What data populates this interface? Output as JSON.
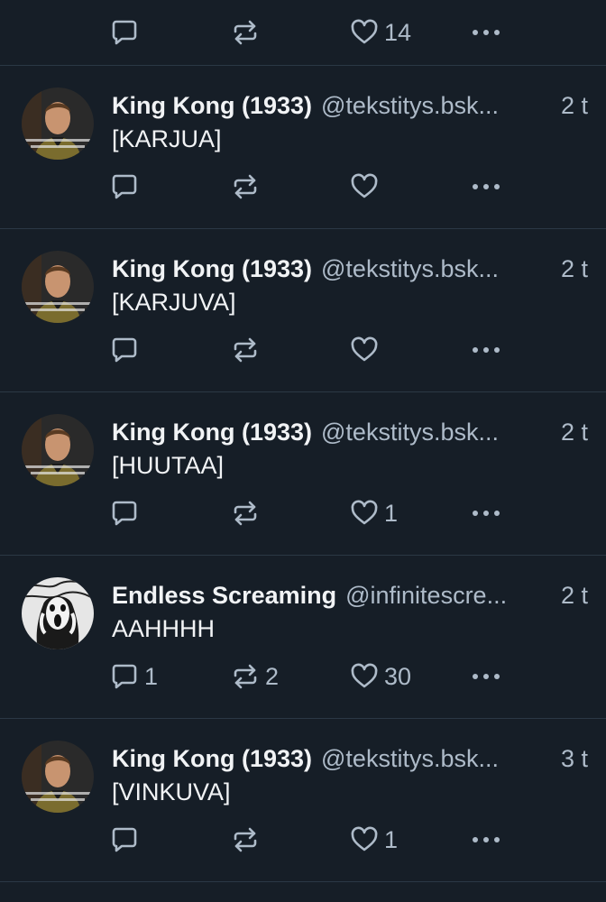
{
  "colors": {
    "background": "#161e27",
    "divider": "#2b3845",
    "text_primary": "#f1f3f5",
    "text_secondary": "#aebbc9"
  },
  "top_actions": {
    "reply_count": "",
    "repost_count": "",
    "like_count": "14"
  },
  "posts": [
    {
      "avatar_icon": "kirk-avatar",
      "display_name": "King Kong (1933)",
      "handle": "@tekstitys.bsk...",
      "time": "2 t",
      "text": "[KARJUA]",
      "reply_count": "",
      "repost_count": "",
      "like_count": ""
    },
    {
      "avatar_icon": "kirk-avatar",
      "display_name": "King Kong (1933)",
      "handle": "@tekstitys.bsk...",
      "time": "2 t",
      "text": "[KARJUVA]",
      "reply_count": "",
      "repost_count": "",
      "like_count": ""
    },
    {
      "avatar_icon": "kirk-avatar",
      "display_name": "King Kong (1933)",
      "handle": "@tekstitys.bsk...",
      "time": "2 t",
      "text": "[HUUTAA]",
      "reply_count": "",
      "repost_count": "",
      "like_count": "1"
    },
    {
      "avatar_icon": "scream-avatar",
      "display_name": "Endless Screaming",
      "handle": "@infinitescre...",
      "time": "2 t",
      "text": "AAHHHH",
      "reply_count": "1",
      "repost_count": "2",
      "like_count": "30"
    },
    {
      "avatar_icon": "kirk-avatar",
      "display_name": "King Kong (1933)",
      "handle": "@tekstitys.bsk...",
      "time": "3 t",
      "text": "[VINKUVA]",
      "reply_count": "",
      "repost_count": "",
      "like_count": "1"
    }
  ]
}
